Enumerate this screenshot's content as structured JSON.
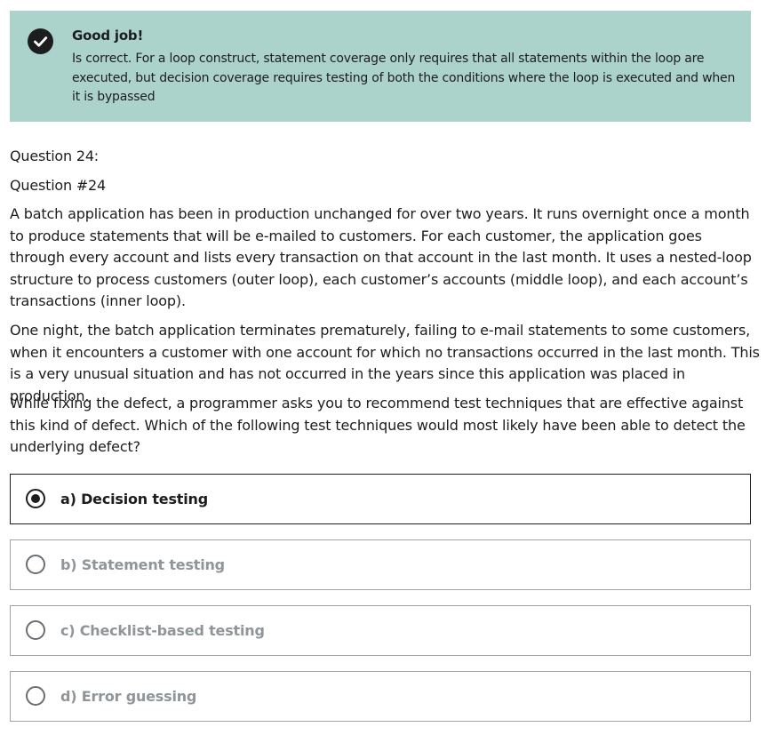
{
  "feedback": {
    "icon": "check-circle-icon",
    "title": "Good job!",
    "explanation": "Is correct. For a loop construct, statement coverage only requires that all statements within the loop are executed, but decision coverage requires testing of both the conditions where the loop is executed and when it is bypassed",
    "background_color": "#acd2cc"
  },
  "question": {
    "number_label": "Question 24:",
    "id_label": "Question #24",
    "paragraphs": [
      "A batch application has been in production unchanged for over two years. It runs overnight once a month to produce statements that will be e-mailed to customers. For each customer, the application goes through every account and lists every transaction on that account in the last month. It uses a nested-loop structure to process customers (outer loop), each customer’s accounts (middle loop), and each account’s transactions (inner loop).",
      "One night, the batch application terminates prematurely, failing to e-mail statements to some customers, when it encounters a customer with one account for which no transactions occurred in the last month. This is a very unusual situation and has not occurred in the years since this application was placed in production.",
      "While fixing the defect, a programmer asks you to recommend test techniques that are effective against this kind of defect. Which of the following test techniques would most likely have been able to detect the underlying defect?"
    ]
  },
  "options": [
    {
      "label": "a) Decision testing",
      "selected": true
    },
    {
      "label": "b) Statement testing",
      "selected": false
    },
    {
      "label": "c) Checklist-based testing",
      "selected": false
    },
    {
      "label": "d) Error guessing",
      "selected": false
    }
  ]
}
